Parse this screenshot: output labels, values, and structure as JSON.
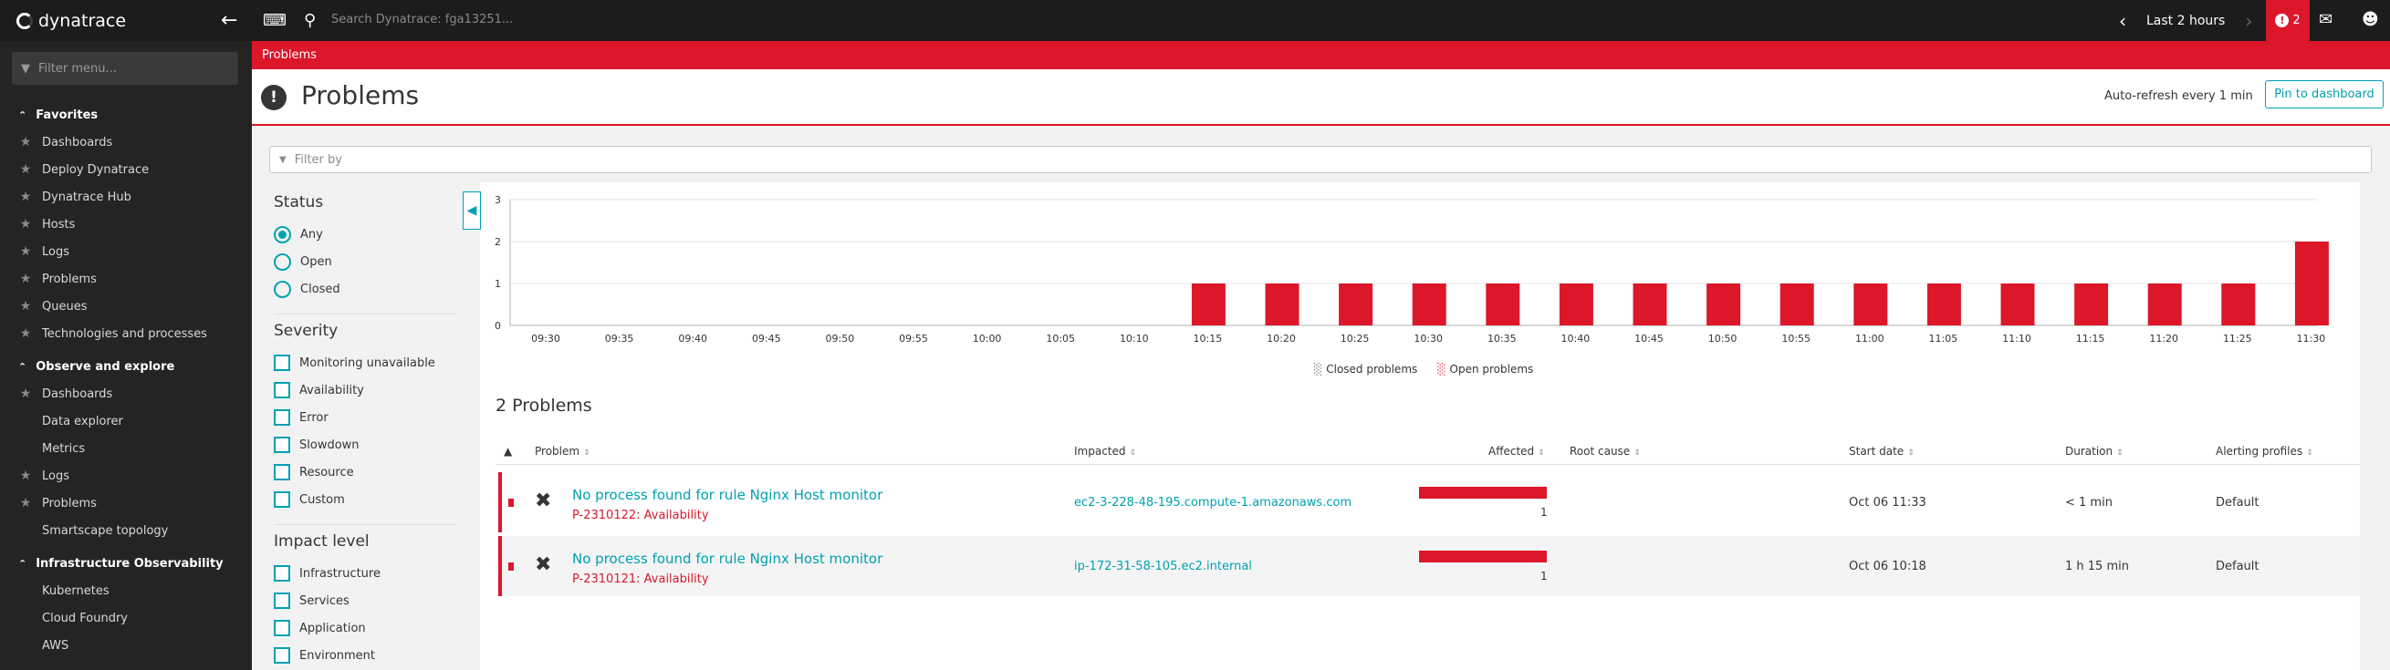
{
  "topbar": {
    "logo_text": "dynatrace",
    "search_placeholder": "Search Dynatrace: fga13251...",
    "timeframe_label": "Last 2 hours",
    "problems_count": "2"
  },
  "sidebar": {
    "filter_placeholder": "Filter menu...",
    "sections": [
      {
        "title": "Favorites",
        "items": [
          {
            "label": "Dashboards",
            "star": true
          },
          {
            "label": "Deploy Dynatrace",
            "star": true
          },
          {
            "label": "Dynatrace Hub",
            "star": true
          },
          {
            "label": "Hosts",
            "star": true
          },
          {
            "label": "Logs",
            "star": true
          },
          {
            "label": "Problems",
            "star": true
          },
          {
            "label": "Queues",
            "star": true
          },
          {
            "label": "Technologies and processes",
            "star": true
          }
        ]
      },
      {
        "title": "Observe and explore",
        "items": [
          {
            "label": "Dashboards",
            "star": true
          },
          {
            "label": "Data explorer",
            "star": false
          },
          {
            "label": "Metrics",
            "star": false
          },
          {
            "label": "Logs",
            "star": true
          },
          {
            "label": "Problems",
            "star": true
          },
          {
            "label": "Smartscape topology",
            "star": false
          }
        ]
      },
      {
        "title": "Infrastructure Observability",
        "items": [
          {
            "label": "Kubernetes",
            "star": false
          },
          {
            "label": "Cloud Foundry",
            "star": false
          },
          {
            "label": "AWS",
            "star": false
          }
        ]
      }
    ]
  },
  "breadcrumb": "Problems",
  "header": {
    "title": "Problems",
    "auto_refresh": "Auto-refresh every 1 min",
    "pin_button": "Pin to dashboard"
  },
  "filter_bar_placeholder": "Filter by",
  "filters": {
    "status_title": "Status",
    "status_options": [
      "Any",
      "Open",
      "Closed"
    ],
    "status_selected": "Any",
    "severity_title": "Severity",
    "severity_options": [
      "Monitoring unavailable",
      "Availability",
      "Error",
      "Slowdown",
      "Resource",
      "Custom"
    ],
    "impact_title": "Impact level",
    "impact_options": [
      "Infrastructure",
      "Services",
      "Application",
      "Environment"
    ]
  },
  "chart_data": {
    "type": "bar",
    "categories": [
      "09:30",
      "09:35",
      "09:40",
      "09:45",
      "09:50",
      "09:55",
      "10:00",
      "10:05",
      "10:10",
      "10:15",
      "10:20",
      "10:25",
      "10:30",
      "10:35",
      "10:40",
      "10:45",
      "10:50",
      "10:55",
      "11:00",
      "11:05",
      "11:10",
      "11:15",
      "11:20",
      "11:25",
      "11:30"
    ],
    "series": [
      {
        "name": "Closed problems",
        "values": [
          0,
          0,
          0,
          0,
          0,
          0,
          0,
          0,
          0,
          0,
          0,
          0,
          0,
          0,
          0,
          0,
          0,
          0,
          0,
          0,
          0,
          0,
          0,
          0,
          0
        ]
      },
      {
        "name": "Open problems",
        "values": [
          0,
          0,
          0,
          0,
          0,
          0,
          0,
          0,
          0,
          1,
          1,
          1,
          1,
          1,
          1,
          1,
          1,
          1,
          1,
          1,
          1,
          1,
          1,
          1,
          2
        ]
      }
    ],
    "ylim": [
      0,
      3
    ],
    "yticks": [
      0,
      1,
      2,
      3
    ],
    "grid": true,
    "legend": "bottom-center",
    "colors": {
      "open": "#dc172a",
      "closed": "#6d6d6d"
    }
  },
  "problems_heading": "2 Problems",
  "table": {
    "columns": [
      "Problem",
      "Impacted",
      "Affected",
      "Root cause",
      "Start date",
      "Duration",
      "Alerting profiles"
    ],
    "rows": [
      {
        "title": "No process found for rule Nginx Host monitor",
        "id": "P-2310122: Availability",
        "impacted": "ec2-3-228-48-195.compute-1.amazonaws.com",
        "affected": "1",
        "root_cause": "",
        "start": "Oct 06 11:33",
        "duration": "< 1 min",
        "profile": "Default"
      },
      {
        "title": "No process found for rule Nginx Host monitor",
        "id": "P-2310121: Availability",
        "impacted": "ip-172-31-58-105.ec2.internal",
        "affected": "1",
        "root_cause": "",
        "start": "Oct 06 10:18",
        "duration": "1 h 15 min",
        "profile": "Default"
      }
    ]
  },
  "colors": {
    "accent": "#00a1b2",
    "problem_red": "#dc172a",
    "sidebar_bg": "#242424",
    "topbar_bg": "#1c1c1c"
  }
}
